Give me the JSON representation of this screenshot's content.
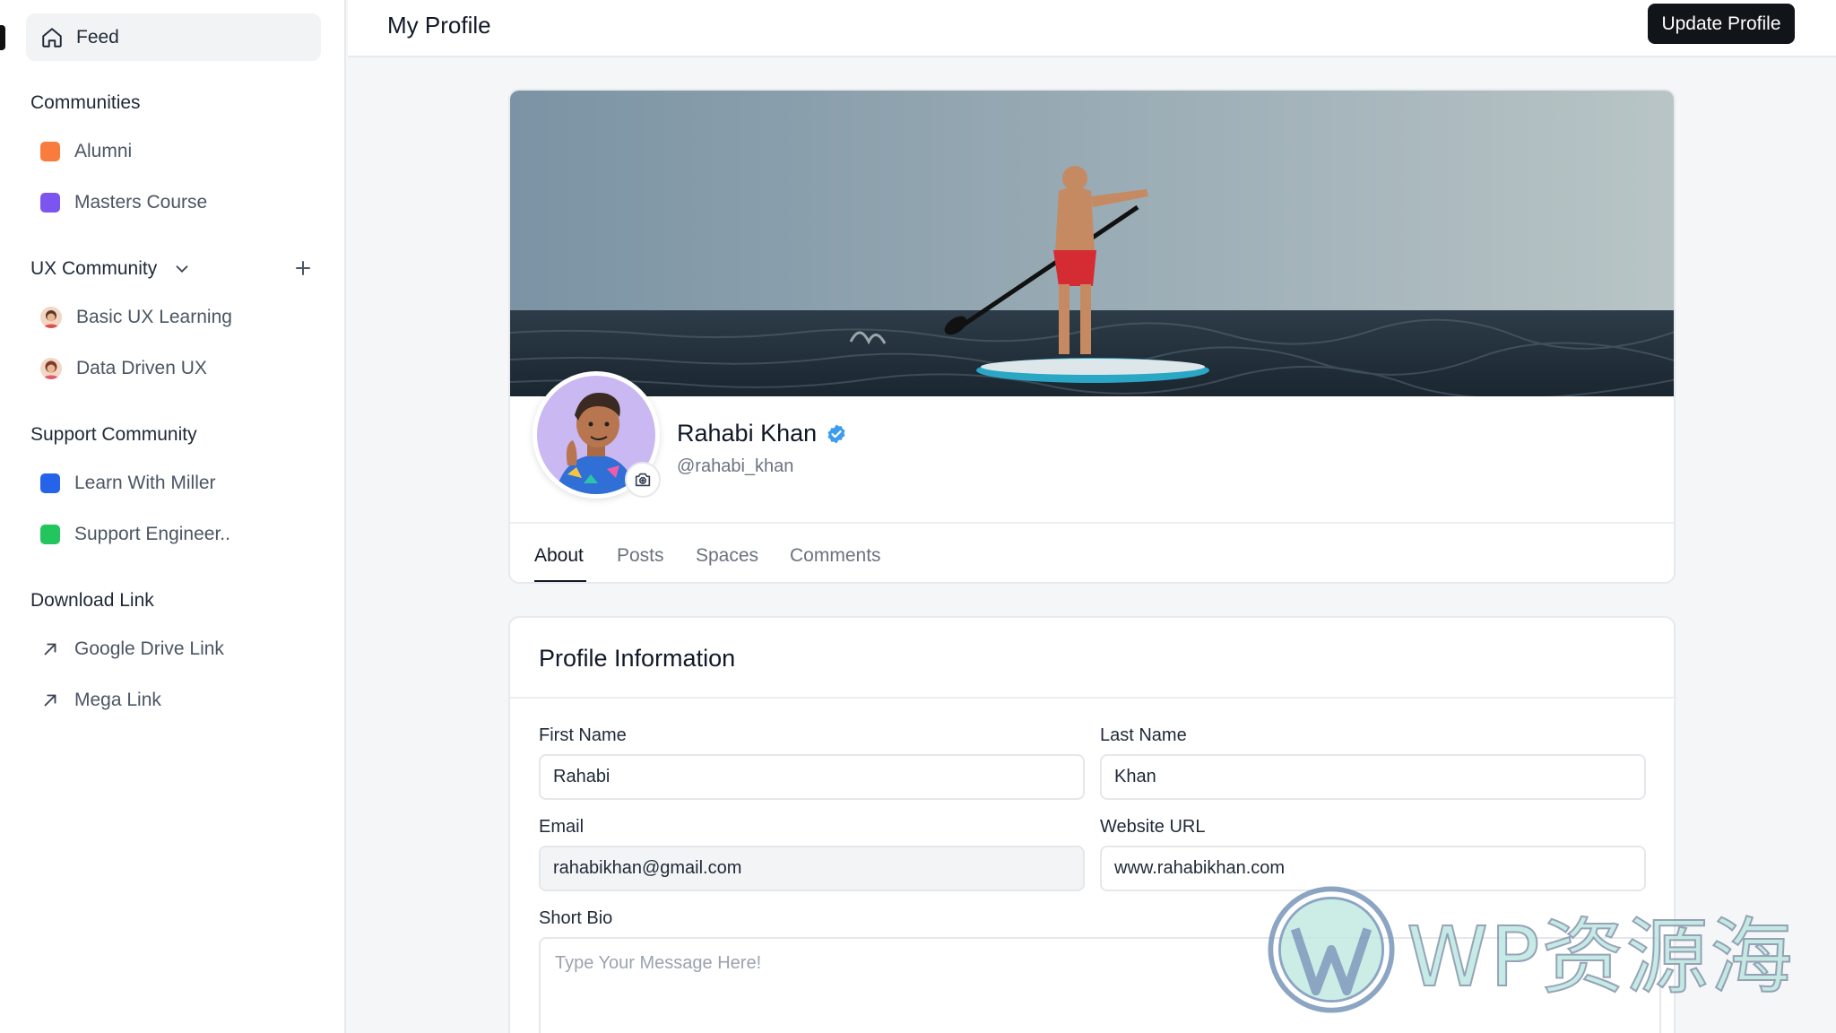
{
  "sidebar": {
    "feed_label": "Feed",
    "groups": [
      {
        "title": "Communities",
        "items": [
          {
            "label": "Alumni",
            "color": "#f97b3d"
          },
          {
            "label": "Masters Course",
            "color": "#7c55f0"
          }
        ]
      },
      {
        "title": "UX Community",
        "items": [
          {
            "label": "Basic UX Learning"
          },
          {
            "label": "Data Driven UX"
          }
        ]
      },
      {
        "title": "Support Community",
        "items": [
          {
            "label": "Learn With Miller",
            "color": "#2563eb"
          },
          {
            "label": "Support Engineer..",
            "color": "#22c55e"
          }
        ]
      },
      {
        "title": "Download Link",
        "items": [
          {
            "label": "Google Drive Link"
          },
          {
            "label": "Mega Link"
          }
        ]
      }
    ]
  },
  "header": {
    "title": "My Profile",
    "update_button": "Update Profile"
  },
  "profile": {
    "name": "Rahabi Khan",
    "handle": "@rahabi_khan",
    "tabs": [
      "About",
      "Posts",
      "Spaces",
      "Comments"
    ],
    "active_tab": "About"
  },
  "info": {
    "title": "Profile Information",
    "first_name_label": "First Name",
    "first_name_value": "Rahabi",
    "last_name_label": "Last Name",
    "last_name_value": "Khan",
    "email_label": "Email",
    "email_value": "rahabikhan@gmail.com",
    "website_label": "Website URL",
    "website_value": "www.rahabikhan.com",
    "bio_label": "Short Bio",
    "bio_placeholder": "Type Your Message Here!"
  },
  "watermark": {
    "text": "WP资源海"
  },
  "colors": {
    "primary_button": "#111418",
    "verified_badge": "#3b9cf0"
  }
}
